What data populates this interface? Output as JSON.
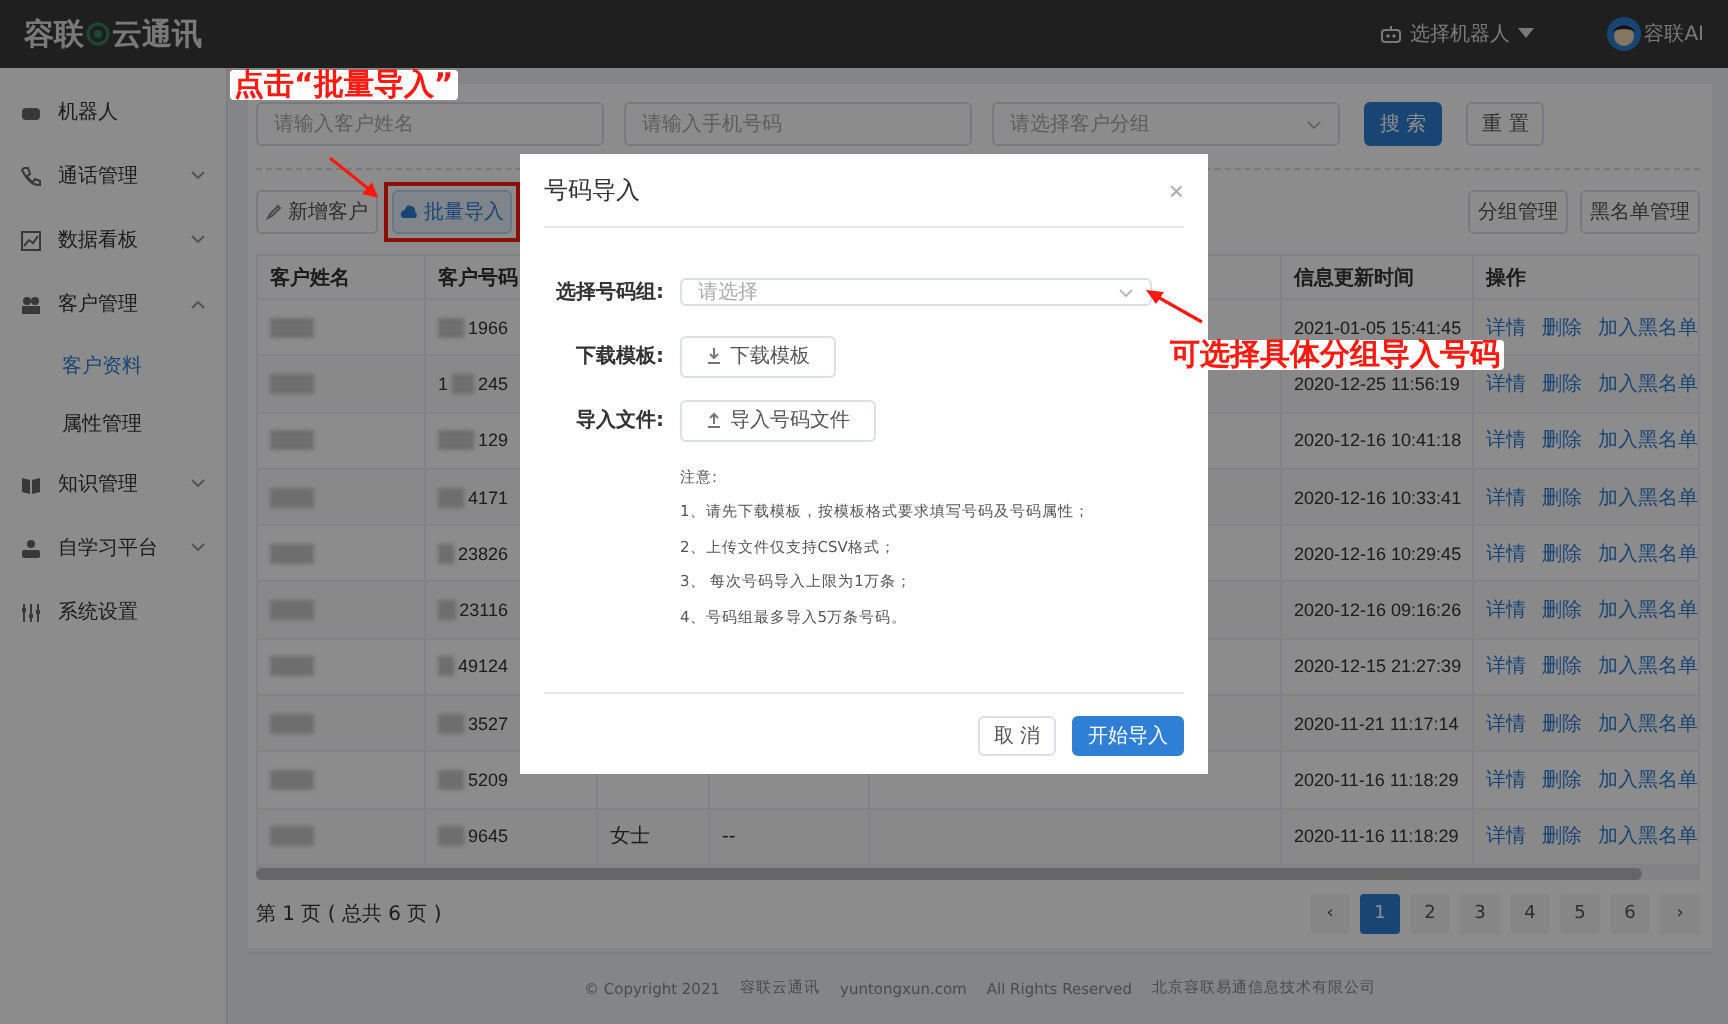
{
  "topbar": {
    "logo_left": "容联",
    "logo_right": "云通讯",
    "robot_select": "选择机器人",
    "user": "容联AI"
  },
  "sidebar": {
    "items": [
      {
        "label": "机器人",
        "selected": false
      },
      {
        "label": "通话管理",
        "expanded": false,
        "selected": false
      },
      {
        "label": "数据看板",
        "expanded": false,
        "selected": false
      },
      {
        "label": "客户管理",
        "expanded": true,
        "selected": false,
        "children": [
          {
            "label": "客户资料",
            "selected": true
          },
          {
            "label": "属性管理",
            "selected": false
          }
        ]
      },
      {
        "label": "知识管理",
        "expanded": false,
        "selected": false
      },
      {
        "label": "自学习平台",
        "expanded": false,
        "selected": false
      },
      {
        "label": "系统设置",
        "selected": false
      }
    ]
  },
  "search": {
    "fields": [
      {
        "placeholder": "请输入客户姓名",
        "kind": "input"
      },
      {
        "placeholder": "请输入手机号码",
        "kind": "input"
      },
      {
        "placeholder": "请选择客户分组",
        "kind": "select"
      }
    ],
    "buttons": [
      {
        "label": "搜 索",
        "primary": true
      },
      {
        "label": "重 置",
        "primary": false
      }
    ]
  },
  "toolbar": {
    "left": [
      "新增客户",
      "批量导入"
    ],
    "right": [
      "分组管理",
      "黑名单管理"
    ]
  },
  "table": {
    "columns": [
      "客户姓名",
      "客户号码",
      "信息更新时间",
      "操作"
    ],
    "rows": [
      {
        "phone": "1966",
        "time": "2021-01-05 15:41:45",
        "actions": [
          "详情",
          "删除",
          "加入黑名单"
        ]
      },
      {
        "phone_head": "1",
        "phone": "245",
        "time": "2020-12-25 11:56:19",
        "actions": [
          "详情",
          "删除",
          "加入黑名单"
        ]
      },
      {
        "phone": "129",
        "time": "2020-12-16 10:41:18",
        "actions": [
          "详情",
          "删除",
          "加入黑名单"
        ]
      },
      {
        "phone": "4171",
        "time": "2020-12-16 10:33:41",
        "actions": [
          "详情",
          "删除",
          "加入黑名单"
        ]
      },
      {
        "phone": "23826",
        "time": "2020-12-16 10:29:45",
        "actions": [
          "详情",
          "删除",
          "加入黑名单"
        ]
      },
      {
        "phone": "23116",
        "time": "2020-12-16 09:16:26",
        "actions": [
          "详情",
          "删除",
          "加入黑名单"
        ]
      },
      {
        "phone": "49124",
        "time": "2020-12-15 21:27:39",
        "actions": [
          "详情",
          "删除",
          "加入黑名单"
        ]
      },
      {
        "phone": "3527",
        "time": "2020-11-21 11:17:14",
        "actions": [
          "详情",
          "删除",
          "加入黑名单"
        ]
      },
      {
        "phone": "5209",
        "time": "2020-11-16 11:18:29",
        "actions": [
          "详情",
          "删除",
          "加入黑名单"
        ]
      },
      {
        "phone": "9645",
        "gender": "女士",
        "column_5": "--",
        "time": "2020-11-16 11:18:29",
        "actions": [
          "详情",
          "删除",
          "加入黑名单"
        ]
      }
    ]
  },
  "pagination": {
    "summary": "第 1 页 ( 总共 6 页 )",
    "prev": "‹",
    "next": "›",
    "pages": [
      {
        "label": "1",
        "selected": true
      },
      {
        "label": "2",
        "selected": false
      },
      {
        "label": "3",
        "selected": false
      },
      {
        "label": "4",
        "selected": false
      },
      {
        "label": "5",
        "selected": false
      },
      {
        "label": "6",
        "selected": false
      }
    ]
  },
  "footer": [
    "© Copyright 2021",
    "容联云通讯",
    "yuntongxun.com",
    "All Rights Reserved",
    "北京容联易通信息技术有限公司"
  ],
  "dialog": {
    "title": "号码导入",
    "close": "×",
    "group_label": "选择号码组:",
    "group_placeholder": "请选择",
    "template_label": "下载模板:",
    "template_button": "下载模板",
    "file_label": "导入文件:",
    "file_button": "导入号码文件",
    "notes": [
      "注意:",
      "1、请先下载模板，按模板格式要求填写号码及号码属性；",
      "2、上传文件仅支持CSV格式；",
      "3、 每次号码导入上限为1万条；",
      "4、号码组最多导入5万条号码。"
    ],
    "buttons": [
      {
        "label": "取 消",
        "primary": false
      },
      {
        "label": "开始导入",
        "primary": true
      }
    ]
  },
  "annotations": [
    "点击“批量导入”",
    "可选择具体分组导入号码"
  ]
}
